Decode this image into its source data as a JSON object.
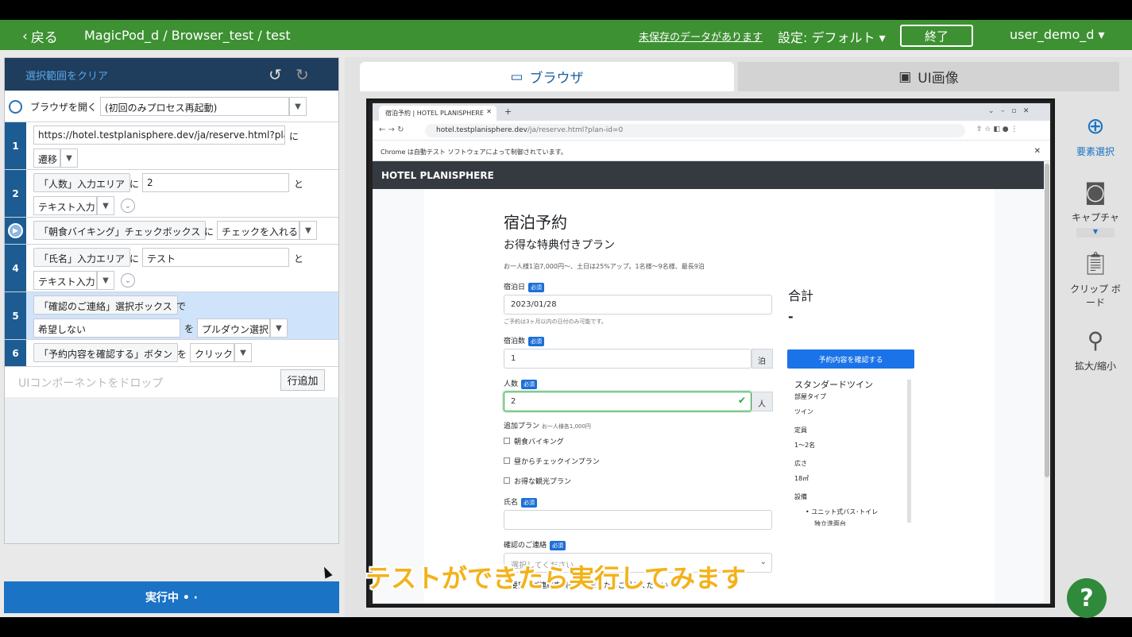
{
  "topbar": {
    "back_label": "戻る",
    "breadcrumb": "MagicPod_d / Browser_test / test",
    "unsaved": "未保存のデータがあります",
    "setting": "設定: デフォルト ▾",
    "end": "終了",
    "user": "user_demo_d ▾"
  },
  "panel": {
    "clear_selection": "選択範囲をクリア",
    "steps": [
      {
        "num": "",
        "chip": "ブラウザを開く",
        "select": "(初回のみプロセス再起動)"
      },
      {
        "num": "1",
        "input": "https://hotel.testplanisphere.dev/ja/reserve.html?plan-id=0",
        "particle": "に",
        "action": "遷移"
      },
      {
        "num": "2",
        "chip": "「人数」入力エリア",
        "particle": "に",
        "input": "2",
        "particle2": "と",
        "action": "テキスト入力"
      },
      {
        "num": "",
        "chip": "「朝食バイキング」チェックボックス",
        "particle": "に",
        "action": "チェックを入れる"
      },
      {
        "num": "4",
        "chip": "「氏名」入力エリア",
        "particle": "に",
        "input": "テスト",
        "particle2": "と",
        "action": "テキスト入力"
      },
      {
        "num": "5",
        "chip": "「確認のご連絡」選択ボックス",
        "particle": "で",
        "input": "希望しない",
        "particle2": "を",
        "action": "プルダウン選択"
      },
      {
        "num": "6",
        "chip": "「予約内容を確認する」ボタン",
        "particle": "を",
        "action": "クリック"
      }
    ],
    "drop_placeholder": "UIコンポーネントをドロップ",
    "add_row": "行追加",
    "run": "実行中 • ·"
  },
  "tabs": {
    "browser": "ブラウザ",
    "ui_image": "UI画像"
  },
  "browser": {
    "tab_title": "宿泊予約 | HOTEL PLANISPHERE",
    "url_host": "hotel.testplanisphere.dev",
    "url_path": "/ja/reserve.html?plan-id=0",
    "automation_notice": "Chrome は自動テスト ソフトウェアによって制御されています。",
    "site_name": "HOTEL PLANISPHERE"
  },
  "reserve": {
    "title": "宿泊予約",
    "plan_name": "お得な特典付きプラン",
    "plan_desc": "お一人様1泊7,000円〜、土日は25%アップ。1名様〜9名様、最長9泊",
    "required": "必須",
    "date_label": "宿泊日",
    "date_value": "2023/01/28",
    "date_help": "ご予約は3ヶ月以内の日付のみ可能です。",
    "nights_label": "宿泊数",
    "nights_value": "1",
    "nights_unit": "泊",
    "people_label": "人数",
    "people_value": "2",
    "people_unit": "人",
    "addon_label": "追加プラン",
    "addon_note": "お一人様各1,000円",
    "addons": [
      "朝食バイキング",
      "昼からチェックインプラン",
      "お得な観光プラン"
    ],
    "name_label": "氏名",
    "contact_label": "確認のご連絡",
    "contact_placeholder": "選択してください",
    "comment_label": "ご要望・ご連絡事項等ありましたらご記入ください",
    "total_label": "合計",
    "total_value": "-",
    "confirm_button": "予約内容を確認する",
    "room": {
      "name": "スタンダードツイン",
      "type_label": "部屋タイプ",
      "type_value": "ツイン",
      "cap_label": "定員",
      "cap_value": "1〜2名",
      "size_label": "広さ",
      "size_value": "18㎡",
      "equip_label": "設備",
      "equip_item": "ユニット式バス･トイレ",
      "equip_item2": "独立洗面台"
    }
  },
  "tools": {
    "select": "要素選択",
    "capture": "キャプチャ",
    "clipboard": "クリップ ボード",
    "zoom": "拡大/縮小",
    "help": "?"
  },
  "caption": "テストができたら実行してみます",
  "colors": {
    "topbar": "#3d9132",
    "panel_head": "#1f3d5c",
    "run": "#1a73c5",
    "caption": "#f3b21a"
  }
}
